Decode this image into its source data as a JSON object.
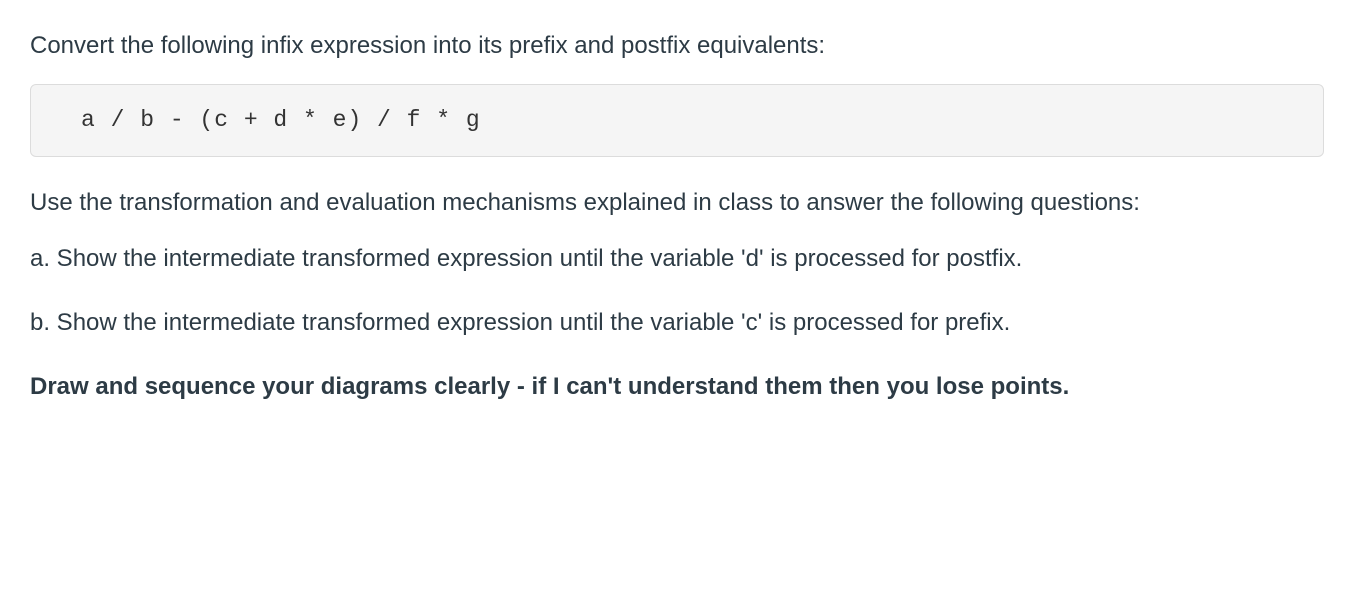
{
  "intro": "Convert the following infix expression into its prefix and postfix equivalents:",
  "expression": "a / b - (c + d * e) / f * g",
  "instructions": "Use the transformation and evaluation mechanisms explained in class to answer the following questions:",
  "question_a": "a. Show the intermediate transformed expression until the variable 'd' is processed for postfix.",
  "question_b": "b. Show the intermediate transformed expression until the variable 'c' is processed for prefix.",
  "closing": "Draw and sequence your diagrams clearly - if I can't understand them then you lose points."
}
